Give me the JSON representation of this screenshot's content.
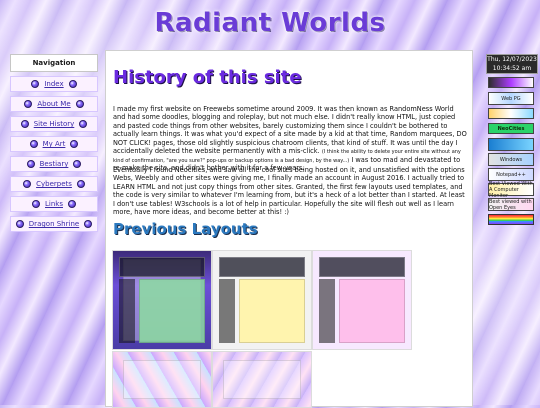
{
  "site": {
    "title": "Radiant Worlds"
  },
  "nav": {
    "header": "Navigation",
    "items": [
      {
        "label": "Index"
      },
      {
        "label": "About Me"
      },
      {
        "label": "Site History"
      },
      {
        "label": "My Art"
      },
      {
        "label": "Bestiary"
      },
      {
        "label": "Cyberpets"
      },
      {
        "label": "Links"
      },
      {
        "label": "Dragon Shrine"
      }
    ]
  },
  "main": {
    "title": "History of this site",
    "p1": "I made my first website on Freewebs sometime around 2009. It was then known as RandomNess World and had some doodles, blogging and roleplay, but not much else. I didn't really know HTML, just copied and pasted code things from other websites, barely customizing them since I couldn't be bothered to actually learn things. It was what you'd expect of a site made by a kid at that time, Random marquees, DO NOT CLICK! pages, those old slightly suspicious chatroom clients, that kind of stuff. It was until the day I accidentally deleted the website permanently with a mis-click.",
    "p1_small": "(I think the ability to delete your entire site without any kind of confirmation, \"are you sure?\" pop-ups or backup options is a bad design, by the way...)",
    "p1_end": "I was too mad and devastated to re-make the site, and didn't bother with it for a few years.",
    "p2": "Eventually I found Neocities, and saw all the cool sites being hosted on it, and unsatisfied with the options Webs, Weebly and other sites were giving me, I finally made an account in August 2016. I actually tried to LEARN HTML and not just copy things from other sites. Granted, the first few layouts used templates, and the code is very similar to whatever I'm learning from, but it's a heck of a lot better than I started. At least I don't use tables! W3schools is a lot of help in particular. Hopefully the site will flesh out well as I learn more, have more ideas, and become better at this! :)",
    "section2": "Previous Layouts"
  },
  "sidebar": {
    "date": "Thu, 12/07/2023",
    "time": "10:34:52 am",
    "badges": {
      "web": "Web",
      "pg": "PG",
      "neocities": "NeoCities",
      "windows": "Windows",
      "notepad": "Notepad++",
      "friends": "Best Viewed With A Computer Monitor",
      "eyes": "Best viewed with Open Eyes"
    }
  },
  "colors": {
    "title": "#6a3cd6",
    "h1": "#6a2ae0",
    "h2": "#2b79bf",
    "link": "#3c2aa9"
  }
}
